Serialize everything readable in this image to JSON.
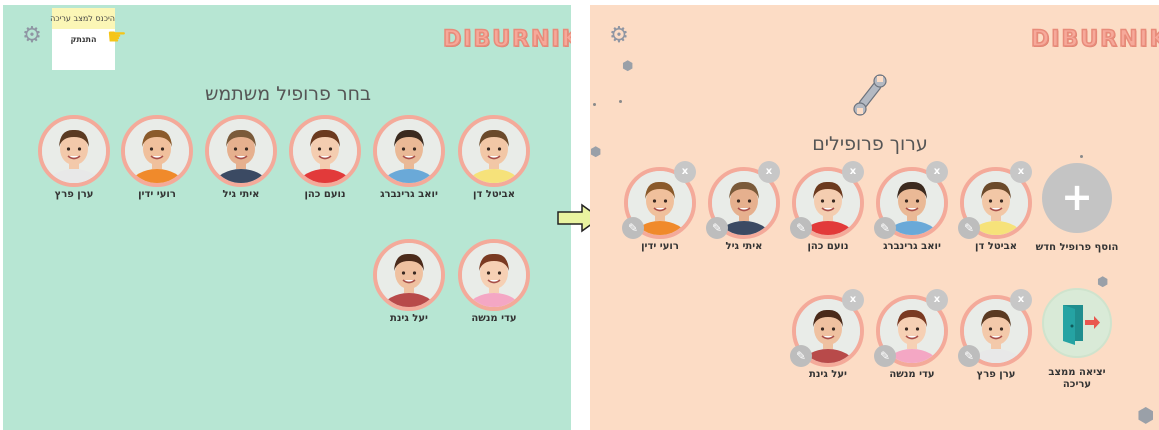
{
  "app": {
    "logo": "DIBURNIK"
  },
  "left_panel": {
    "title": "בחר פרופיל משתמש",
    "popup": {
      "header": "היכנס למצב עריכה",
      "item": "התנתק"
    },
    "icons": {
      "settings": "gear-icon",
      "pointer": "pointing-hand-icon"
    },
    "profiles": [
      {
        "name": "אביטל דן",
        "shirt": "#f6e27a",
        "hair": "#6b4a2b"
      },
      {
        "name": "יואב גרינברג",
        "shirt": "#6aa9d8",
        "hair": "#3b2a1f"
      },
      {
        "name": "נועם כהן",
        "shirt": "#e23a3a",
        "hair": "#6b3a1f"
      },
      {
        "name": "איתי גיל",
        "shirt": "#3b4a63",
        "hair": "#7a5a3a"
      },
      {
        "name": "רועי ידין",
        "shirt": "#f08a2b",
        "hair": "#8a5a2b"
      },
      {
        "name": "ערן  פרץ",
        "shirt": "#e8e8e8",
        "hair": "#5a3a22"
      },
      {
        "name": "עדי מנשה",
        "shirt": "#f4a7c4",
        "hair": "#7a3a22"
      },
      {
        "name": "יעל גינת",
        "shirt": "#b84a4a",
        "hair": "#4a2a1a"
      }
    ]
  },
  "right_panel": {
    "title": "ערוך פרופילים",
    "add_label": "הוסף פרופיל חדש",
    "exit_label": "יציאה ממצב עריכה",
    "delete_glyph": "x",
    "edit_glyph": "✎",
    "icons": {
      "settings": "gear-icon",
      "edit_mode": "wrench-icon",
      "add": "plus-icon",
      "exit": "exit-door-icon"
    },
    "profiles": [
      {
        "name": "אביטל דן",
        "shirt": "#f6e27a",
        "hair": "#6b4a2b"
      },
      {
        "name": "יואב גרינברג",
        "shirt": "#6aa9d8",
        "hair": "#3b2a1f"
      },
      {
        "name": "נועם כהן",
        "shirt": "#e23a3a",
        "hair": "#6b3a1f"
      },
      {
        "name": "איתי גיל",
        "shirt": "#3b4a63",
        "hair": "#7a5a3a"
      },
      {
        "name": "רועי ידין",
        "shirt": "#f08a2b",
        "hair": "#8a5a2b"
      },
      {
        "name": "ערן  פרץ",
        "shirt": "#e8e8e8",
        "hair": "#5a3a22"
      },
      {
        "name": "עדי מנשה",
        "shirt": "#f4a7c4",
        "hair": "#7a3a22"
      },
      {
        "name": "יעל גינת",
        "shirt": "#b84a4a",
        "hair": "#4a2a1a"
      }
    ]
  },
  "colors": {
    "left_bg": "#b7e6d3",
    "right_bg": "#fcdcc5",
    "avatar_ring": "#f4aa9a",
    "logo": "#f6a99a",
    "arrow": "#e9f3a0"
  }
}
